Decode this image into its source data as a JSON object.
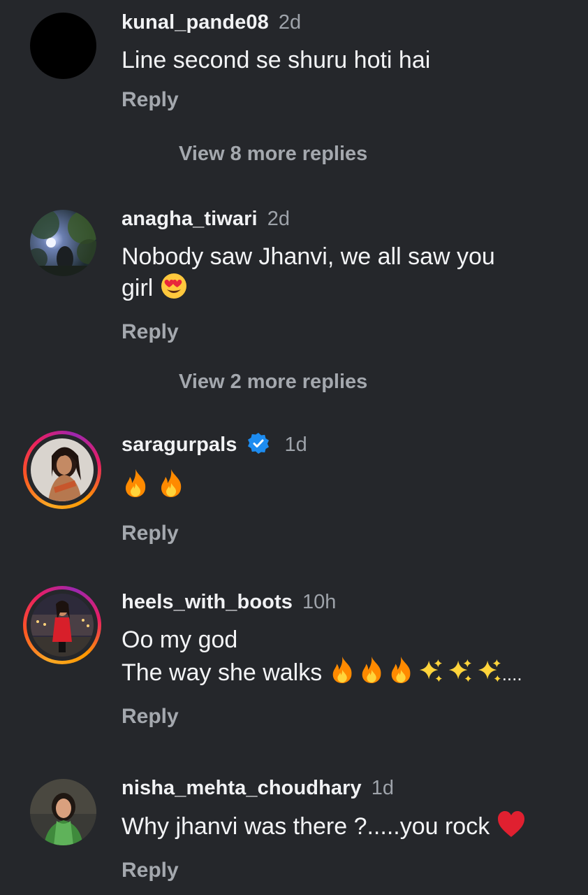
{
  "comments": [
    {
      "username": "kunal_pande08",
      "time": "2d",
      "lines": [
        "Line second se shuru hoti hai"
      ],
      "reply": "Reply",
      "view_more": "View 8 more replies",
      "avatar": "black-avatar"
    },
    {
      "username": "anagha_tiwari",
      "time": "2d",
      "lines": [
        "Nobody saw Jhanvi, we all saw you",
        "girl"
      ],
      "reply": "Reply",
      "view_more": "View 2 more replies",
      "avatar": "tree-photo-avatar",
      "emoji": "heart-eyes-emoji"
    },
    {
      "username": "saragurpals",
      "time": "1d",
      "verified": true,
      "lines": [
        ""
      ],
      "reply": "Reply",
      "avatar": "woman-photo-story-ring-avatar",
      "emoji": "fire-emoji-x2"
    },
    {
      "username": "heels_with_boots",
      "time": "10h",
      "lines": [
        "Oo my god",
        "The way she walks"
      ],
      "trailing_text": "....",
      "reply": "Reply",
      "avatar": "woman-red-dress-story-ring-avatar",
      "emoji": "fire-x3-sparkles-x3"
    },
    {
      "username": "nisha_mehta_choudhary",
      "time": "1d",
      "lines": [
        "Why jhanvi was there ?.....you rock"
      ],
      "reply": "Reply",
      "avatar": "woman-green-photo-avatar",
      "emoji": "red-heart-emoji"
    }
  ],
  "colors": {
    "background": "#25272b",
    "text": "#f1f2f4",
    "secondary": "#a4a8ae",
    "verified": "#1d8cf0"
  }
}
